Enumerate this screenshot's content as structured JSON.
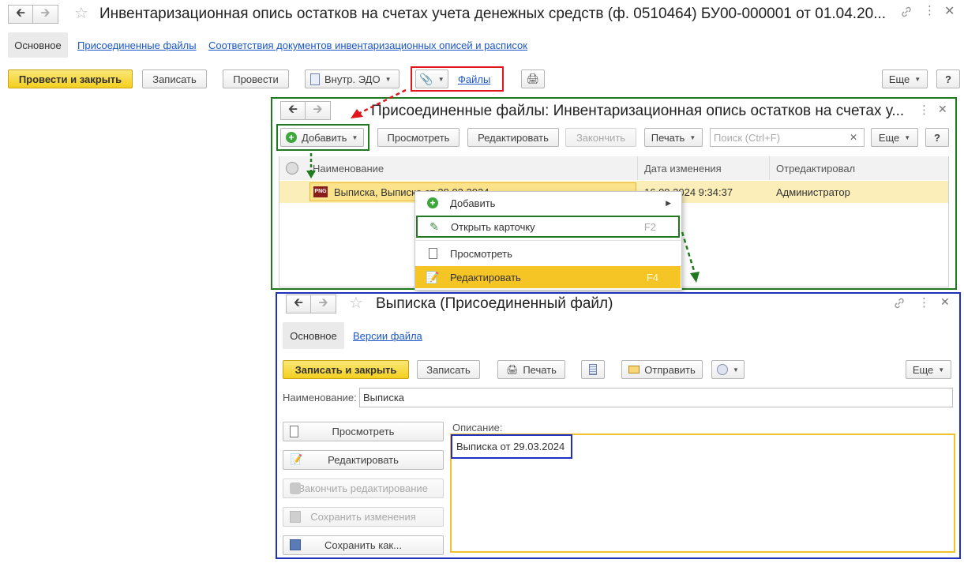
{
  "main_window": {
    "title": "Инвентаризационная опись остатков на счетах учета денежных средств (ф. 0510464) БУ00-000001 от 01.04.20...",
    "tabs": [
      {
        "label": "Основное"
      },
      {
        "label": "Присоединенные файлы"
      },
      {
        "label": "Соответствия документов инвентаризационных описей и расписок"
      }
    ],
    "toolbar": {
      "post_close": "Провести и закрыть",
      "save": "Записать",
      "post": "Провести",
      "edo": "Внутр. ЭДО",
      "files": "Файлы",
      "more": "Еще",
      "help": "?"
    }
  },
  "files_window": {
    "title": "Присоединенные файлы: Инвентаризационная опись остатков на счетах у...",
    "toolbar": {
      "add": "Добавить",
      "view": "Просмотреть",
      "edit": "Редактировать",
      "finish": "Закончить",
      "print": "Печать",
      "search_placeholder": "Поиск (Ctrl+F)",
      "more": "Еще",
      "help": "?"
    },
    "table": {
      "columns": [
        "Наименование",
        "Дата изменения",
        "Отредактировал"
      ],
      "rows": [
        {
          "name": "Выписка, Выписка от 29.03.2024",
          "date": "16.09.2024 9:34:37",
          "editor": "Администратор"
        }
      ]
    },
    "context_menu": [
      {
        "label": "Добавить",
        "shortcut": ""
      },
      {
        "label": "Открыть карточку",
        "shortcut": "F2"
      },
      {
        "label": "Просмотреть",
        "shortcut": ""
      },
      {
        "label": "Редактировать",
        "shortcut": "F4"
      }
    ]
  },
  "file_card": {
    "title": "Выписка (Присоединенный файл)",
    "tabs": [
      {
        "label": "Основное"
      },
      {
        "label": "Версии файла"
      }
    ],
    "toolbar": {
      "save_close": "Записать и закрыть",
      "save": "Записать",
      "print": "Печать",
      "send": "Отправить",
      "more": "Еще"
    },
    "name_label": "Наименование:",
    "name_value": "Выписка",
    "description_label": "Описание:",
    "description_value": "Выписка от 29.03.2024",
    "side_buttons": [
      {
        "label": "Просмотреть"
      },
      {
        "label": "Редактировать"
      },
      {
        "label": "Закончить редактирование"
      },
      {
        "label": "Сохранить изменения"
      },
      {
        "label": "Сохранить как..."
      }
    ]
  },
  "colors": {
    "highlight_red": "#e0161c",
    "highlight_green": "#1f7a1f",
    "highlight_blue": "#1f2fbf",
    "accent_yellow": "#f5d234",
    "link_blue": "#1a56c8"
  }
}
